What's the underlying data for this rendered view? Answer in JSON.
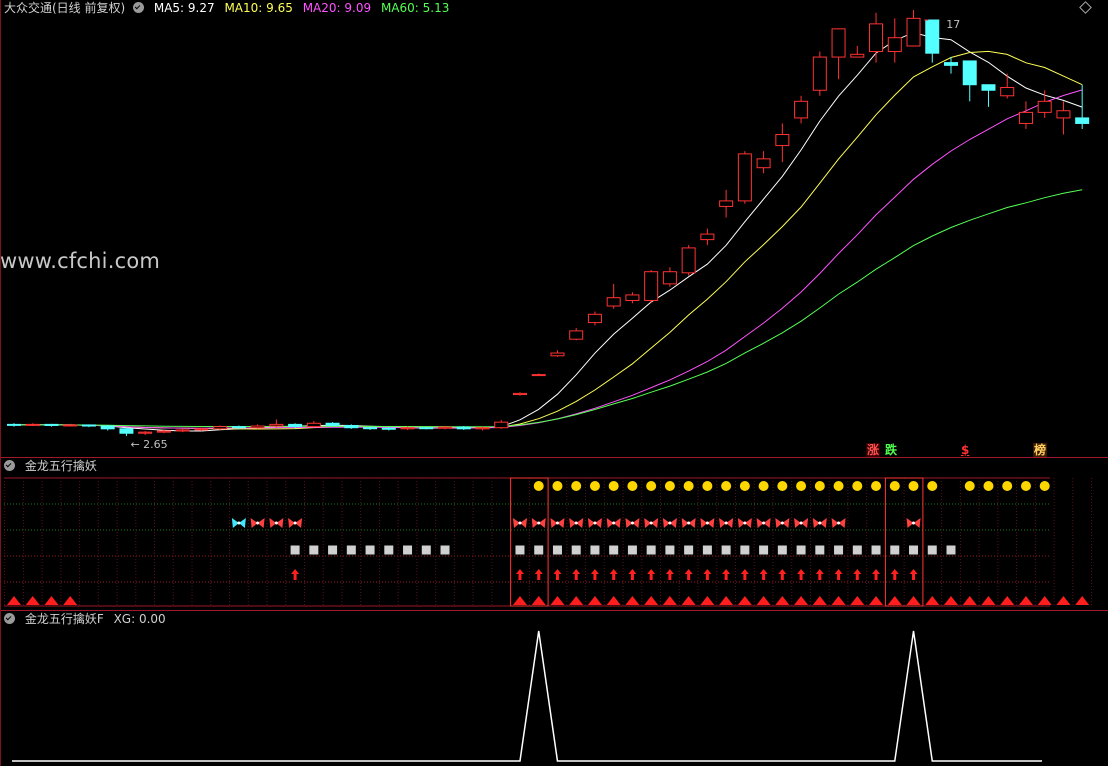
{
  "main_header": {
    "title": "大众交通(日线 前复权)",
    "ma5": "MA5: 9.27",
    "ma10": "MA10: 9.65",
    "ma20": "MA20: 9.09",
    "ma60": "MA60: 5.13"
  },
  "watermark": "www.cfchi.com",
  "price_labels": {
    "high": "17",
    "low": "2.65"
  },
  "badges": {
    "rise": "涨",
    "fall": "跌",
    "dollar": "$",
    "rank": "榜"
  },
  "pane2_header": {
    "title": "金龙五行擒妖"
  },
  "pane3_header": {
    "title": "金龙五行擒妖F",
    "xg": "XG: 0.00"
  },
  "colors": {
    "up": "#ff3232",
    "down": "#54ffff",
    "ma5": "#ffffff",
    "ma10": "#ffff54",
    "ma20": "#ff54ff",
    "ma60": "#54ff54",
    "grid_red": "#a0192a",
    "grid_green": "#1e7a1e"
  },
  "chart_data": [
    {
      "type": "candlestick",
      "title": "大众交通(日线 前复权)",
      "price_range": [
        2.65,
        10.17
      ],
      "candles": [
        [
          2.86,
          2.85,
          2.88,
          2.82
        ],
        [
          2.85,
          2.86,
          2.88,
          2.83
        ],
        [
          2.86,
          2.84,
          2.87,
          2.82
        ],
        [
          2.84,
          2.85,
          2.87,
          2.82
        ],
        [
          2.85,
          2.83,
          2.86,
          2.81
        ],
        [
          2.83,
          2.78,
          2.85,
          2.75
        ],
        [
          2.78,
          2.7,
          2.8,
          2.65
        ],
        [
          2.7,
          2.72,
          2.74,
          2.67
        ],
        [
          2.72,
          2.74,
          2.76,
          2.7
        ],
        [
          2.74,
          2.76,
          2.78,
          2.72
        ],
        [
          2.76,
          2.78,
          2.8,
          2.74
        ],
        [
          2.78,
          2.82,
          2.84,
          2.76
        ],
        [
          2.82,
          2.8,
          2.84,
          2.77
        ],
        [
          2.8,
          2.83,
          2.86,
          2.78
        ],
        [
          2.83,
          2.86,
          2.95,
          2.8
        ],
        [
          2.86,
          2.82,
          2.88,
          2.79
        ],
        [
          2.82,
          2.88,
          2.92,
          2.8
        ],
        [
          2.88,
          2.84,
          2.9,
          2.82
        ],
        [
          2.84,
          2.8,
          2.86,
          2.78
        ],
        [
          2.8,
          2.79,
          2.82,
          2.76
        ],
        [
          2.79,
          2.78,
          2.81,
          2.75
        ],
        [
          2.78,
          2.8,
          2.82,
          2.76
        ],
        [
          2.8,
          2.79,
          2.82,
          2.77
        ],
        [
          2.79,
          2.81,
          2.83,
          2.77
        ],
        [
          2.81,
          2.78,
          2.83,
          2.76
        ],
        [
          2.78,
          2.8,
          2.82,
          2.75
        ],
        [
          2.8,
          2.9,
          2.94,
          2.78
        ],
        [
          3.4,
          3.42,
          3.44,
          3.38
        ],
        [
          3.76,
          3.76,
          3.78,
          3.74
        ],
        [
          4.1,
          4.15,
          4.2,
          4.08
        ],
        [
          4.4,
          4.55,
          4.6,
          4.38
        ],
        [
          4.7,
          4.85,
          4.9,
          4.65
        ],
        [
          5.0,
          5.15,
          5.4,
          4.95
        ],
        [
          5.1,
          5.2,
          5.25,
          5.05
        ],
        [
          5.1,
          5.62,
          5.65,
          5.05
        ],
        [
          5.4,
          5.62,
          5.7,
          5.35
        ],
        [
          5.6,
          6.05,
          6.1,
          5.55
        ],
        [
          6.2,
          6.3,
          6.4,
          6.1
        ],
        [
          6.8,
          6.9,
          7.1,
          6.6
        ],
        [
          6.9,
          7.75,
          7.8,
          6.85
        ],
        [
          7.5,
          7.66,
          7.8,
          7.4
        ],
        [
          7.9,
          8.1,
          8.3,
          7.6
        ],
        [
          8.4,
          8.7,
          8.8,
          8.3
        ],
        [
          8.9,
          9.5,
          9.6,
          8.8
        ],
        [
          9.5,
          10.01,
          10.02,
          9.1
        ],
        [
          9.5,
          9.55,
          9.7,
          9.5
        ],
        [
          9.6,
          10.1,
          10.3,
          9.4
        ],
        [
          9.6,
          9.85,
          10.2,
          9.4
        ],
        [
          9.7,
          10.2,
          10.35,
          9.7
        ],
        [
          10.17,
          9.57,
          10.17,
          9.4
        ],
        [
          9.4,
          9.35,
          9.5,
          9.2
        ],
        [
          9.43,
          9.0,
          9.43,
          8.7
        ],
        [
          9.0,
          8.9,
          9.0,
          8.6
        ],
        [
          8.8,
          8.95,
          9.2,
          8.75
        ],
        [
          8.3,
          8.5,
          8.7,
          8.2
        ],
        [
          8.5,
          8.7,
          8.9,
          8.4
        ],
        [
          8.4,
          8.53,
          8.7,
          8.1
        ],
        [
          8.4,
          8.3,
          9.0,
          8.2
        ]
      ],
      "series": [
        {
          "name": "MA5",
          "value": 9.27
        },
        {
          "name": "MA10",
          "value": 9.65
        },
        {
          "name": "MA20",
          "value": 9.09
        },
        {
          "name": "MA60",
          "value": 5.13
        }
      ]
    },
    {
      "type": "signal-matrix",
      "title": "金龙五行擒妖",
      "count": 58,
      "rows": {
        "yellow_dot": [
          [
            28,
            49
          ],
          [
            51,
            55
          ]
        ],
        "butterfly": [
          [
            12,
            15
          ],
          [
            27,
            44
          ],
          [
            48,
            48
          ]
        ],
        "square": [
          [
            15,
            23
          ],
          [
            27,
            50
          ]
        ],
        "up_arrow": [
          [
            15,
            15
          ],
          [
            27,
            48
          ]
        ],
        "triangle": [
          [
            0,
            3
          ],
          [
            27,
            57
          ]
        ]
      },
      "butterfly_cyan": [
        12
      ],
      "boxes": [
        [
          27,
          28
        ],
        [
          47,
          48
        ]
      ]
    },
    {
      "type": "line",
      "title": "金龙五行擒妖F",
      "xg": 0.0,
      "spikes": [
        28,
        48
      ],
      "ylim": [
        0,
        1
      ]
    }
  ]
}
